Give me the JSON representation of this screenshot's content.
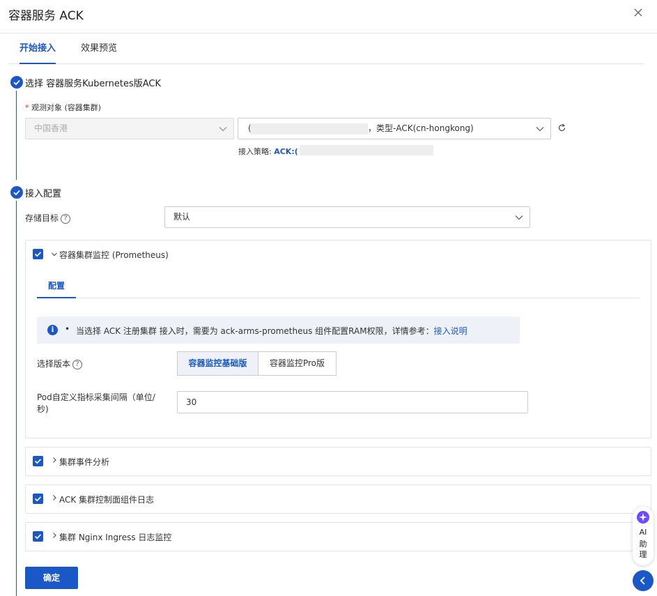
{
  "header": {
    "title": "容器服务 ACK"
  },
  "tabs": [
    {
      "label": "开始接入",
      "active": true
    },
    {
      "label": "效果预览",
      "active": false
    }
  ],
  "step1": {
    "title": "选择 容器服务Kubernetes版ACK",
    "required_mark": "*",
    "field_label": "观测对象 (容器集群)",
    "region_value": "中国香港",
    "cluster_value_prefix": "(",
    "cluster_value_suffix": "，类型-ACK(cn-hongkong)",
    "policy_label": "接入策略:",
    "policy_value": "ACK:("
  },
  "step2": {
    "title": "接入配置",
    "storage_label": "存储目标",
    "storage_value": "默认",
    "help_glyph": "?"
  },
  "prometheus": {
    "title": "容器集群监控 (Prometheus)",
    "checked": true,
    "inner_tab": "配置",
    "notice_bullet": "•",
    "notice_text": "当选择 ACK 注册集群 接入时，需要为 ack-arms-prometheus 组件配置RAM权限，详情参考：",
    "notice_link": "接入说明",
    "version_label": "选择版本",
    "version_options": [
      "容器监控基础版",
      "容器监控Pro版"
    ],
    "version_selected": "容器监控基础版",
    "interval_label_line1": "Pod自定义指标采集间隔（单位/",
    "interval_label_line2": "秒)",
    "interval_value": "30"
  },
  "sections": [
    {
      "title": "集群事件分析",
      "checked": true
    },
    {
      "title": "ACK 集群控制面组件日志",
      "checked": true
    },
    {
      "title": "集群 Nginx Ingress 日志监控",
      "checked": true
    }
  ],
  "footer": {
    "confirm_label": "确定"
  },
  "assistant": {
    "line1": "AI",
    "line2": "助",
    "line3": "理"
  },
  "colors": {
    "primary": "#1b58c7",
    "border": "#e3e3e3",
    "notice_bg": "#eef2f8"
  },
  "icons": {
    "close": "close-icon",
    "check": "check-icon",
    "chevron": "chevron-down-icon",
    "refresh": "refresh-icon",
    "info": "info-icon",
    "help": "help-icon",
    "ai": "ai-assistant-icon",
    "collapse": "chevron-left-icon"
  }
}
